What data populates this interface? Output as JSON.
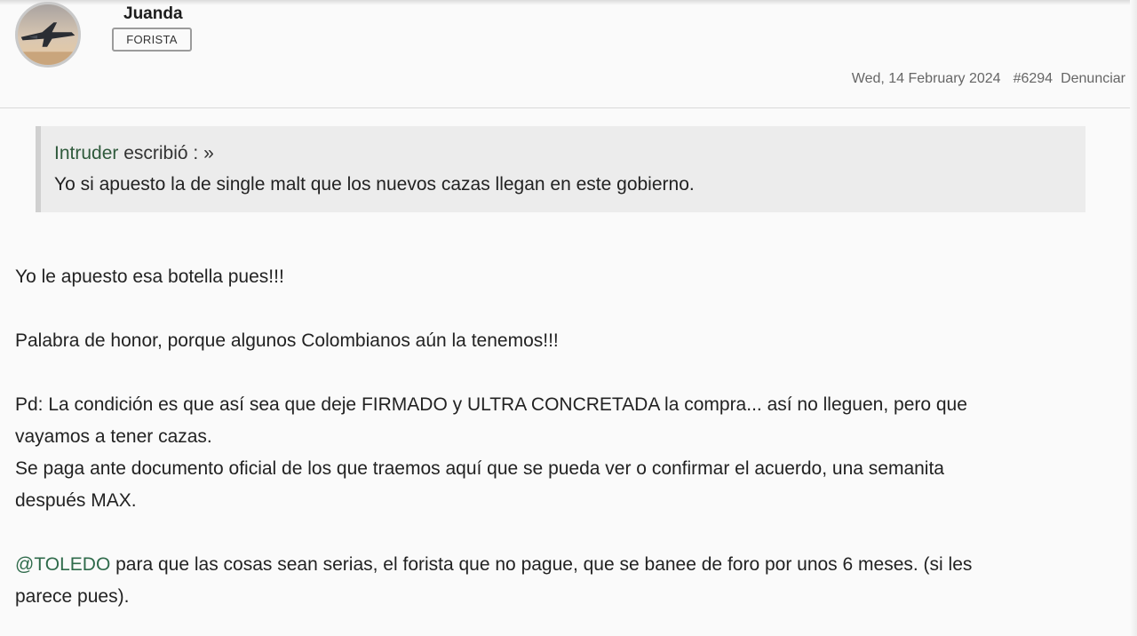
{
  "author": {
    "name": "Juanda",
    "role": "FORISTA",
    "avatar_icon": "fighter-jet-avatar-icon"
  },
  "post_meta": {
    "date": "Wed, 14 February 2024",
    "number": "#6294",
    "report_label": "Denunciar"
  },
  "quote": {
    "author": "Intruder",
    "wrote_label": " escribió : »",
    "text": "Yo si apuesto la de single malt que los nuevos cazas llegan en este gobierno."
  },
  "body": {
    "line1": "Yo le apuesto esa botella pues!!!",
    "line2": "Palabra de honor, porque algunos Colombianos aún la tenemos!!!",
    "para3_a": "Pd: La condición es que así sea que deje FIRMADO y ULTRA CONCRETADA la compra... así no lleguen, pero que",
    "para3_b": "vayamos a tener cazas.",
    "para3_c": "Se paga ante documento oficial de los que traemos aquí que se pueda ver o confirmar el acuerdo, una semanita",
    "para3_d": "después MAX.",
    "mention": "@TOLEDO",
    "para4_a": " para que las cosas sean serias, el forista que no pague, que se banee de foro por unos 6 meses. (si les",
    "para4_b": "parece pues)."
  },
  "colors": {
    "mention": "#2f6b4b",
    "quote_author": "#2f5a3c",
    "quote_bg": "#ececec"
  }
}
